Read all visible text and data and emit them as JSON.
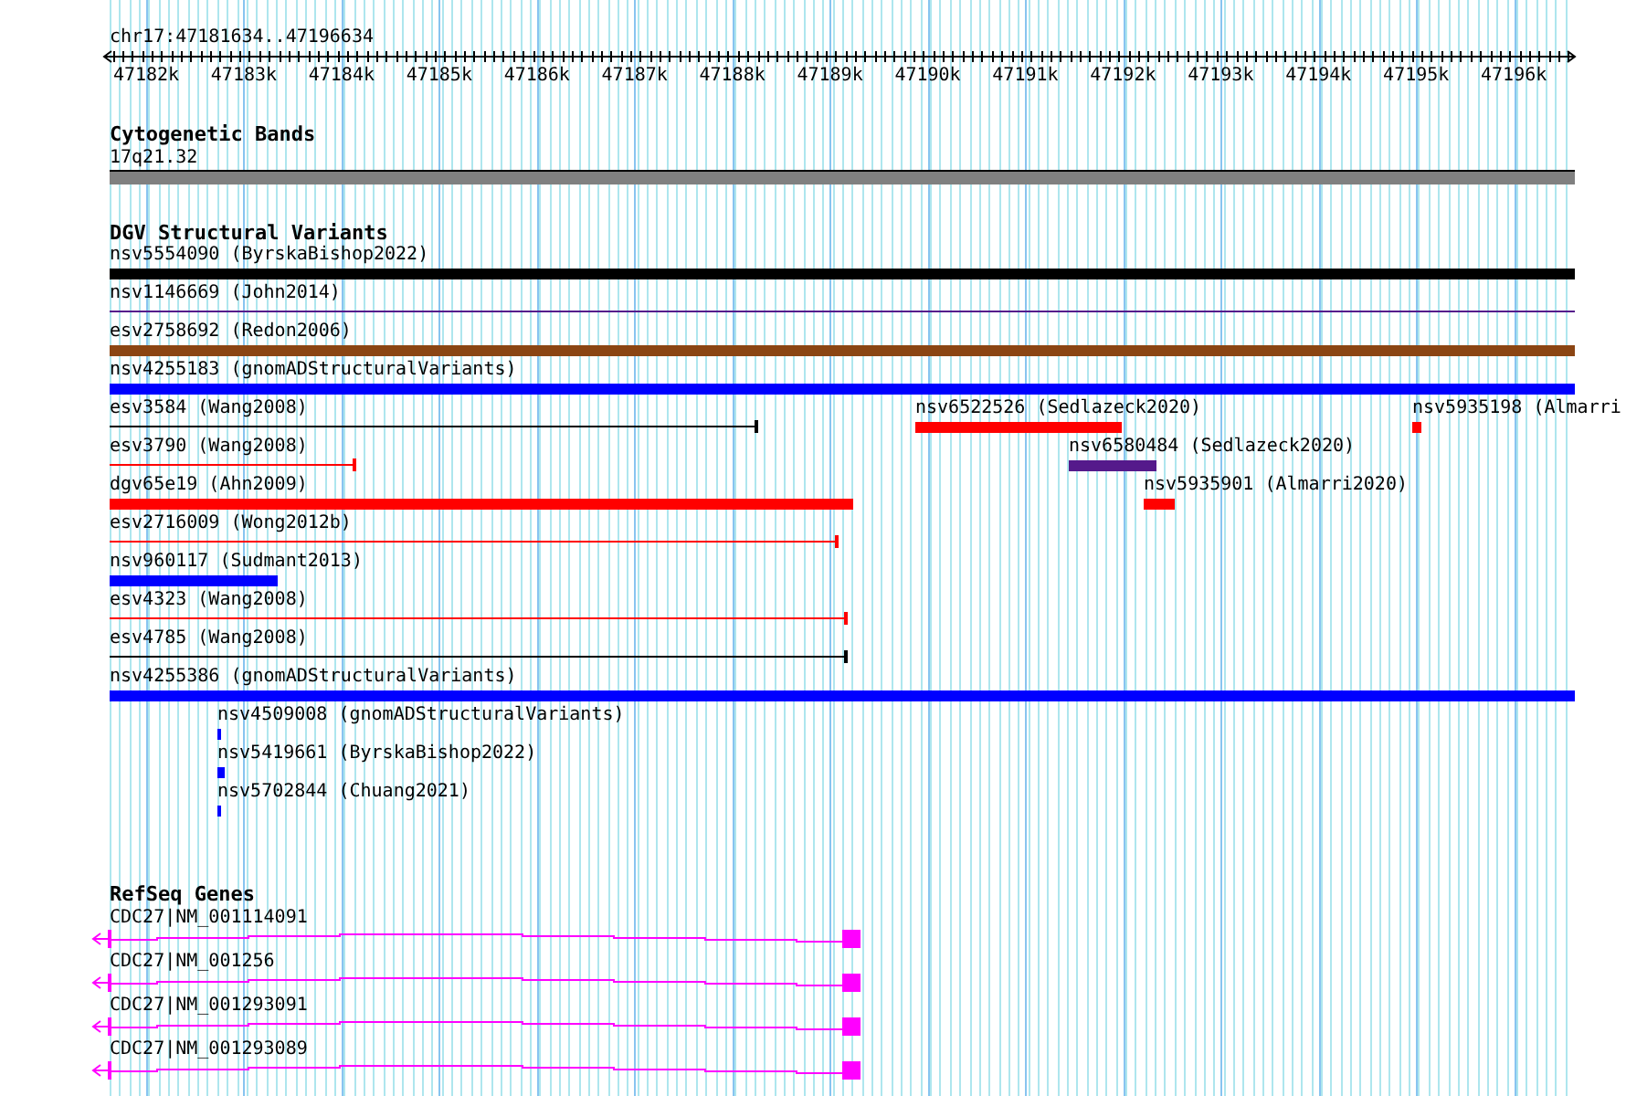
{
  "ruler": {
    "location": "chr17:47181634..47196634",
    "ticks": [
      "47182k",
      "47183k",
      "47184k",
      "47185k",
      "47186k",
      "47187k",
      "47188k",
      "47189k",
      "47190k",
      "47191k",
      "47192k",
      "47193k",
      "47194k",
      "47195k",
      "47196k"
    ]
  },
  "cytoband_track": {
    "title": "Cytogenetic Bands",
    "band": "17q21.32"
  },
  "dgv_track": {
    "title": "DGV Structural Variants",
    "features": [
      {
        "label": "nsv5554090 (ByrskaBishop2022)",
        "kind": "bar",
        "color": "#000000"
      },
      {
        "label": "nsv1146669 (John2014)",
        "kind": "thin",
        "color": "#551a8b"
      },
      {
        "label": "esv2758692 (Redon2006)",
        "kind": "bar",
        "color": "#8b4513"
      },
      {
        "label": "nsv4255183 (gnomADStructuralVariants)",
        "kind": "bar",
        "color": "#0000ff"
      },
      {
        "label": "esv3584 (Wang2008)",
        "kind": "line",
        "color": "#000000"
      },
      {
        "label": "nsv6522526 (Sedlazeck2020)",
        "kind": "bar",
        "color": "#ff0000"
      },
      {
        "label": "nsv5935198 (Almarri",
        "kind": "bar",
        "color": "#ff0000"
      },
      {
        "label": "esv3790 (Wang2008)",
        "kind": "line",
        "color": "#ff0000"
      },
      {
        "label": "nsv6580484 (Sedlazeck2020)",
        "kind": "bar",
        "color": "#551a8b"
      },
      {
        "label": "dgv65e19 (Ahn2009)",
        "kind": "bar",
        "color": "#ff0000"
      },
      {
        "label": "nsv5935901 (Almarri2020)",
        "kind": "bar",
        "color": "#ff0000"
      },
      {
        "label": "esv2716009 (Wong2012b)",
        "kind": "line",
        "color": "#ff0000"
      },
      {
        "label": "nsv960117 (Sudmant2013)",
        "kind": "bar",
        "color": "#0000ff"
      },
      {
        "label": "esv4323 (Wang2008)",
        "kind": "line",
        "color": "#ff0000"
      },
      {
        "label": "esv4785 (Wang2008)",
        "kind": "line",
        "color": "#000000"
      },
      {
        "label": "nsv4255386 (gnomADStructuralVariants)",
        "kind": "bar",
        "color": "#0000ff"
      },
      {
        "label": "nsv4509008 (gnomADStructuralVariants)",
        "kind": "bar",
        "color": "#0000ff"
      },
      {
        "label": "nsv5419661 (ByrskaBishop2022)",
        "kind": "bar",
        "color": "#0000ff"
      },
      {
        "label": "nsv5702844 (Chuang2021)",
        "kind": "bar",
        "color": "#0000ff"
      }
    ]
  },
  "refseq_track": {
    "title": "RefSeq Genes",
    "transcripts": [
      {
        "label": "CDC27|NM_001114091"
      },
      {
        "label": "CDC27|NM_001256"
      },
      {
        "label": "CDC27|NM_001293091"
      },
      {
        "label": "CDC27|NM_001293089"
      }
    ]
  }
}
